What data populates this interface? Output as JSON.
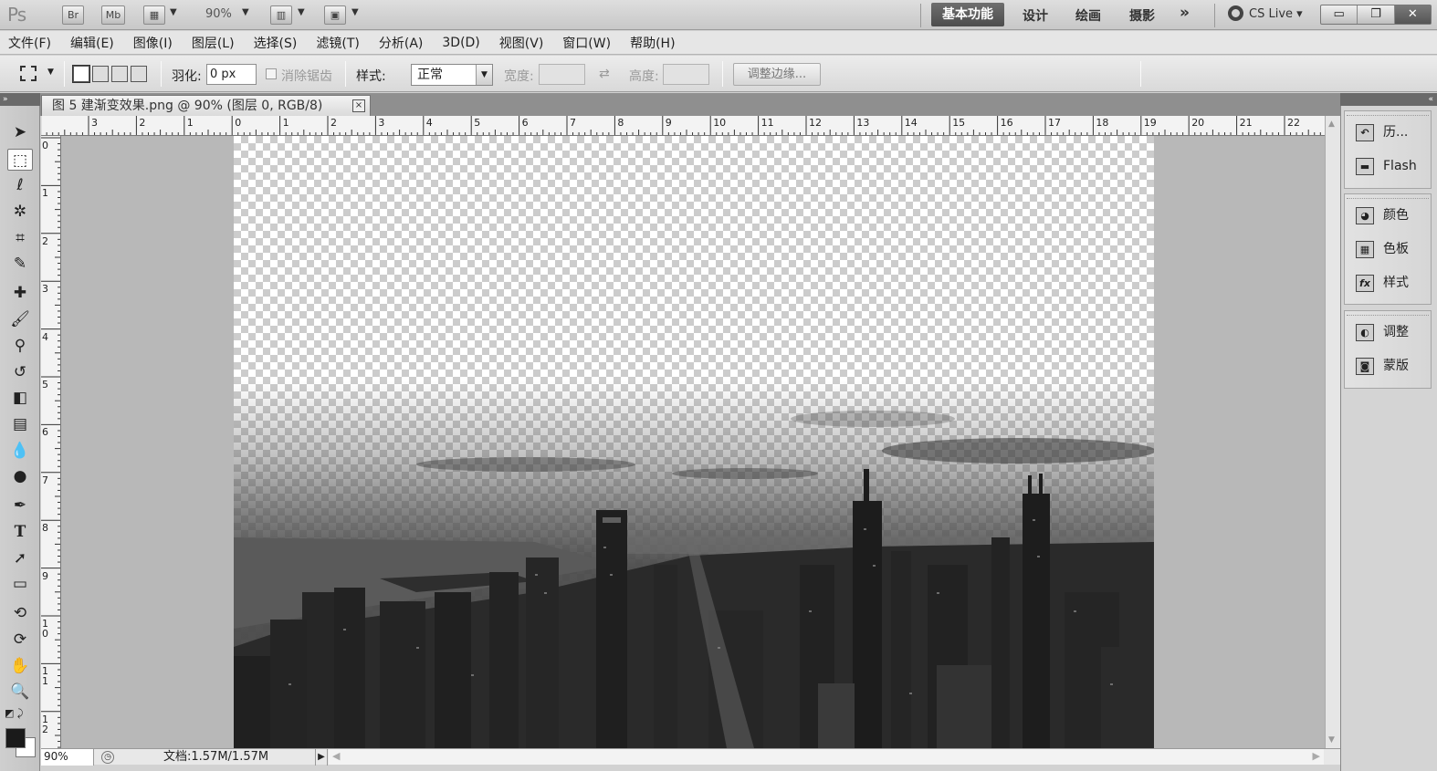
{
  "appbar": {
    "logo": "Ps",
    "bridge": "Br",
    "minibridge": "Mb",
    "zoom": "90%",
    "workspaces": [
      "基本功能",
      "设计",
      "绘画",
      "摄影"
    ],
    "more": "»",
    "cslive": "CS Live"
  },
  "menu": [
    "文件(F)",
    "编辑(E)",
    "图像(I)",
    "图层(L)",
    "选择(S)",
    "滤镜(T)",
    "分析(A)",
    "3D(D)",
    "视图(V)",
    "窗口(W)",
    "帮助(H)"
  ],
  "options": {
    "feather_label": "羽化:",
    "feather_value": "0 px",
    "antialias_label": "消除锯齿",
    "style_label": "样式:",
    "style_value": "正常",
    "width_label": "宽度:",
    "height_label": "高度:",
    "refine_label": "调整边缘..."
  },
  "document": {
    "tab_title": "图 5  建渐变效果.png @ 90% (图层 0, RGB/8)",
    "close": "×"
  },
  "rulers": {
    "h_labels": [
      "3",
      "2",
      "1",
      "0",
      "1",
      "2",
      "3",
      "4",
      "5",
      "6",
      "7",
      "8",
      "9",
      "10",
      "11",
      "12",
      "13",
      "14",
      "15",
      "16",
      "17",
      "18",
      "19",
      "20",
      "21",
      "22"
    ],
    "v_labels": [
      "0",
      "1",
      "2",
      "3",
      "4",
      "5",
      "6",
      "7",
      "8",
      "9",
      "10",
      "11",
      "12"
    ]
  },
  "status": {
    "zoom": "90%",
    "doc_info": "文档:1.57M/1.57M"
  },
  "panels": {
    "group1": [
      {
        "icon": "history-icon",
        "label": "历..."
      },
      {
        "icon": "flash-icon",
        "label": "Flash"
      }
    ],
    "group2": [
      {
        "icon": "color-icon",
        "label": "颜色"
      },
      {
        "icon": "swatches-icon",
        "label": "色板"
      },
      {
        "icon": "styles-icon",
        "label": "样式"
      }
    ],
    "group3": [
      {
        "icon": "adjustments-icon",
        "label": "调整"
      },
      {
        "icon": "masks-icon",
        "label": "蒙版"
      }
    ]
  }
}
